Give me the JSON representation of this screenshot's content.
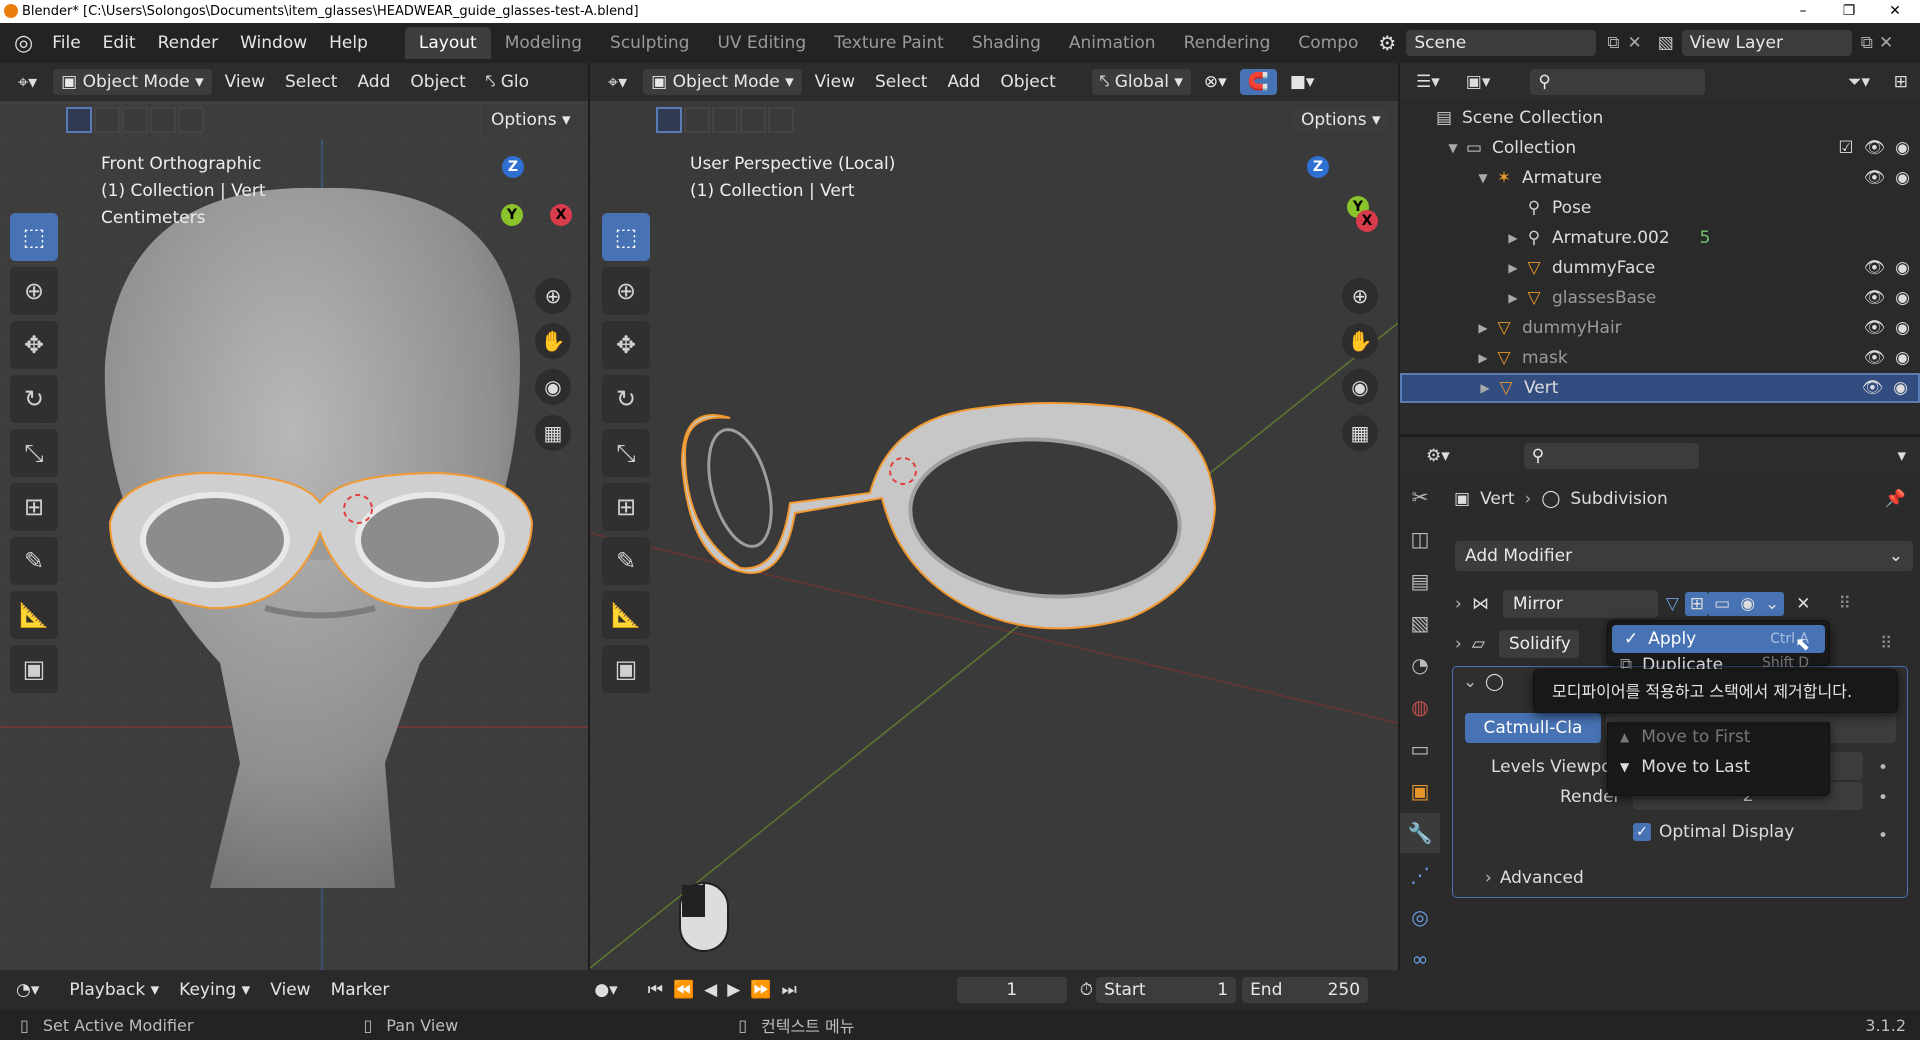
{
  "window": {
    "title": "Blender* [C:\\Users\\Solongos\\Documents\\item_glasses\\HEADWEAR_guide_glasses-test-A.blend]",
    "min": "–",
    "max": "❐",
    "close": "✕"
  },
  "menu": [
    "File",
    "Edit",
    "Render",
    "Window",
    "Help"
  ],
  "workspace_tabs": [
    "Layout",
    "Modeling",
    "Sculpting",
    "UV Editing",
    "Texture Paint",
    "Shading",
    "Animation",
    "Rendering",
    "Compo"
  ],
  "scene": {
    "label": "Scene",
    "view_layer": "View Layer"
  },
  "left_view": {
    "mode": "Object Mode",
    "menus": [
      "View",
      "Select",
      "Add",
      "Object"
    ],
    "transform_cut": "Glo",
    "options": "Options",
    "info": [
      "Front Orthographic",
      "(1) Collection | Vert",
      "Centimeters"
    ],
    "axes": {
      "z": "Z",
      "y": "Y",
      "x": "X"
    }
  },
  "right_view": {
    "mode": "Object Mode",
    "menus": [
      "View",
      "Select",
      "Add",
      "Object"
    ],
    "transform": "Global",
    "options": "Options",
    "info": [
      "User Perspective (Local)",
      "(1) Collection | Vert"
    ],
    "axes": {
      "z": "Z",
      "y": "Y",
      "x": "X"
    }
  },
  "outliner": {
    "rows": [
      {
        "label": "Scene Collection",
        "indent": 0,
        "icon": "scene-collection-icon",
        "glyph": "▤",
        "tri": ""
      },
      {
        "label": "Collection",
        "indent": 1,
        "icon": "collection-icon",
        "glyph": "▭",
        "tri": "▼"
      },
      {
        "label": "Armature",
        "indent": 2,
        "icon": "armature-icon",
        "glyph": "✶",
        "tri": "▼"
      },
      {
        "label": "Pose",
        "indent": 3,
        "icon": "pose-icon",
        "glyph": "⚲",
        "tri": ""
      },
      {
        "label": "Armature.002",
        "indent": 3,
        "icon": "armature-data-icon",
        "glyph": "⚲",
        "tri": "▶"
      },
      {
        "label": "dummyFace",
        "indent": 3,
        "icon": "mesh-object-icon",
        "glyph": "▽",
        "tri": "▶"
      },
      {
        "label": "glassesBase",
        "indent": 3,
        "icon": "mesh-object-icon",
        "glyph": "▽",
        "tri": "▶"
      },
      {
        "label": "dummyHair",
        "indent": 2,
        "icon": "mesh-object-icon",
        "glyph": "▽",
        "tri": "▶"
      },
      {
        "label": "mask",
        "indent": 2,
        "icon": "mesh-object-icon",
        "glyph": "▽",
        "tri": "▶"
      },
      {
        "label": "Vert",
        "indent": 2,
        "icon": "mesh-object-icon",
        "glyph": "▽",
        "tri": "▶"
      }
    ],
    "armature_count": "5"
  },
  "properties": {
    "breadcrumb_obj": "Vert",
    "breadcrumb_mod": "Subdivision",
    "add_modifier": "Add Modifier",
    "modifiers": [
      "Mirror",
      "Solidify"
    ],
    "subdiv_type": "Catmull-Cla",
    "levels_viewport": "Levels Viewpo",
    "render": "Render",
    "render_val": "2",
    "optimal_display": "Optimal Display",
    "advanced": "Advanced"
  },
  "dropdown": {
    "apply": "Apply",
    "apply_shortcut": "Ctrl A",
    "duplicate": "Duplicate",
    "duplicate_shortcut": "Shift D",
    "move_first": "Move to First",
    "move_last": "Move to Last",
    "tooltip": "모디파이어를 적용하고 스택에서 제거합니다."
  },
  "timeline": {
    "menus": [
      "Playback",
      "Keying",
      "View",
      "Marker"
    ],
    "frame": "1",
    "start_label": "Start",
    "start": "1",
    "end_label": "End",
    "end": "250"
  },
  "status": {
    "left": "Set Active Modifier",
    "mid": "Pan View",
    "ctx": "컨텍스트 메뉴",
    "version": "3.1.2"
  }
}
